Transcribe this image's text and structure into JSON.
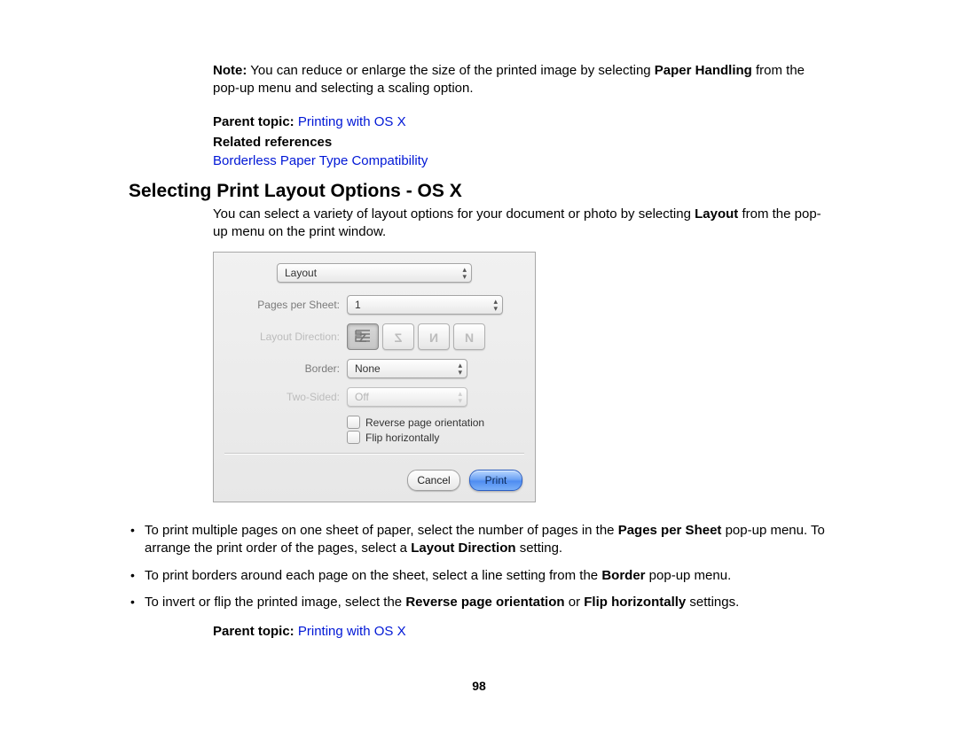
{
  "note": {
    "label": "Note:",
    "text_before": " You can reduce or enlarge the size of the printed image by selecting ",
    "bold1": "Paper Handling",
    "text_after": " from the pop-up menu and selecting a scaling option."
  },
  "parent_topic": {
    "label": "Parent topic:",
    "link": "Printing with OS X"
  },
  "related": {
    "heading": "Related references",
    "link": "Borderless Paper Type Compatibility"
  },
  "section_title": "Selecting Print Layout Options - OS X",
  "intro": {
    "pre": "You can select a variety of layout options for your document or photo by selecting ",
    "bold": "Layout",
    "post": " from the pop-up menu on the print window."
  },
  "dialog": {
    "menu": "Layout",
    "pages_per_sheet_label": "Pages per Sheet:",
    "pages_per_sheet_value": "1",
    "layout_direction_label": "Layout Direction:",
    "border_label": "Border:",
    "border_value": "None",
    "two_sided_label": "Two-Sided:",
    "two_sided_value": "Off",
    "reverse_label": "Reverse page orientation",
    "flip_label": "Flip horizontally",
    "cancel": "Cancel",
    "print": "Print"
  },
  "bullets": {
    "b1_a": "To print multiple pages on one sheet of paper, select the number of pages in the ",
    "b1_bold1": "Pages per Sheet",
    "b1_b": " pop-up menu. To arrange the print order of the pages, select a ",
    "b1_bold2": "Layout Direction",
    "b1_c": " setting.",
    "b2_a": "To print borders around each page on the sheet, select a line setting from the ",
    "b2_bold": "Border",
    "b2_b": " pop-up menu.",
    "b3_a": "To invert or flip the printed image, select the ",
    "b3_bold1": "Reverse page orientation",
    "b3_b": " or ",
    "b3_bold2": "Flip horizontally",
    "b3_c": " settings."
  },
  "parent_topic2": {
    "label": "Parent topic:",
    "link": "Printing with OS X"
  },
  "page_number": "98"
}
